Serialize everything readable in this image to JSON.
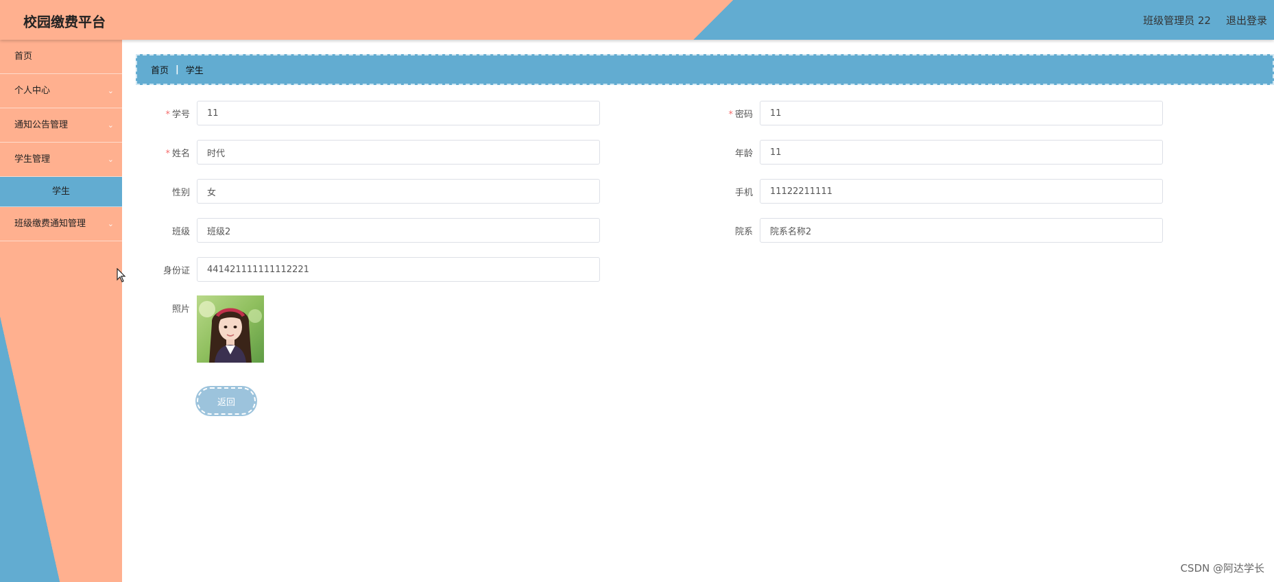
{
  "header": {
    "title": "校园缴费平台",
    "user": "班级管理员 22",
    "logout": "退出登录"
  },
  "sidebar": {
    "items": [
      {
        "label": "首页",
        "chevron": false
      },
      {
        "label": "个人中心",
        "chevron": true
      },
      {
        "label": "通知公告管理",
        "chevron": true
      },
      {
        "label": "学生管理",
        "chevron": true
      },
      {
        "label": "学生",
        "chevron": false,
        "active_sub": true
      },
      {
        "label": "班级缴费通知管理",
        "chevron": true
      }
    ]
  },
  "breadcrumb": {
    "home": "首页",
    "separator": "|",
    "current": "学生"
  },
  "form": {
    "student_id": {
      "label": "学号",
      "required": true,
      "value": "11"
    },
    "password": {
      "label": "密码",
      "required": true,
      "value": "11"
    },
    "name": {
      "label": "姓名",
      "required": true,
      "value": "时代"
    },
    "age": {
      "label": "年龄",
      "required": false,
      "value": "11"
    },
    "gender": {
      "label": "性别",
      "required": false,
      "value": "女"
    },
    "phone": {
      "label": "手机",
      "required": false,
      "value": "11122211111"
    },
    "class": {
      "label": "班级",
      "required": false,
      "value": "班级2"
    },
    "department": {
      "label": "院系",
      "required": false,
      "value": "院系名称2"
    },
    "id_card": {
      "label": "身份证",
      "required": false,
      "value": "441421111111112221"
    },
    "photo": {
      "label": "照片"
    }
  },
  "required_mark": "*",
  "back_button": "返回",
  "watermark": "CSDN @阿达学长",
  "colors": {
    "peach": "#ffb08f",
    "blue": "#62acd1",
    "button": "#9cc3dc",
    "required": "#f56c6c"
  },
  "icons": {
    "chevron": "chevron-down-icon",
    "cursor": "mouse-pointer-icon"
  }
}
